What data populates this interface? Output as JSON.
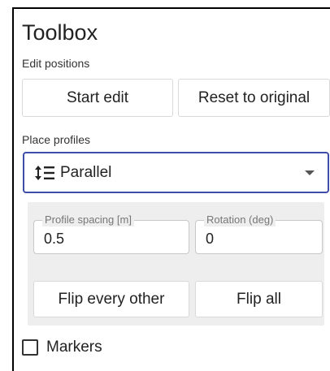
{
  "toolbox": {
    "title": "Toolbox",
    "edit_positions": {
      "label": "Edit positions",
      "start_edit": "Start edit",
      "reset_original": "Reset to original"
    },
    "place_profiles": {
      "label": "Place profiles",
      "mode_icon": "vertical-arrows-lines-icon",
      "mode_selected": "Parallel",
      "profile_spacing": {
        "label": "Profile spacing [m]",
        "value": "0.5"
      },
      "rotation": {
        "label": "Rotation (deg)",
        "value": "0"
      },
      "flip_every_other": "Flip every other",
      "flip_all": "Flip all"
    },
    "markers": {
      "label": "Markers",
      "checked": false
    }
  },
  "colors": {
    "accent": "#3f4da8",
    "subpanel_bg": "#eeeeee"
  }
}
